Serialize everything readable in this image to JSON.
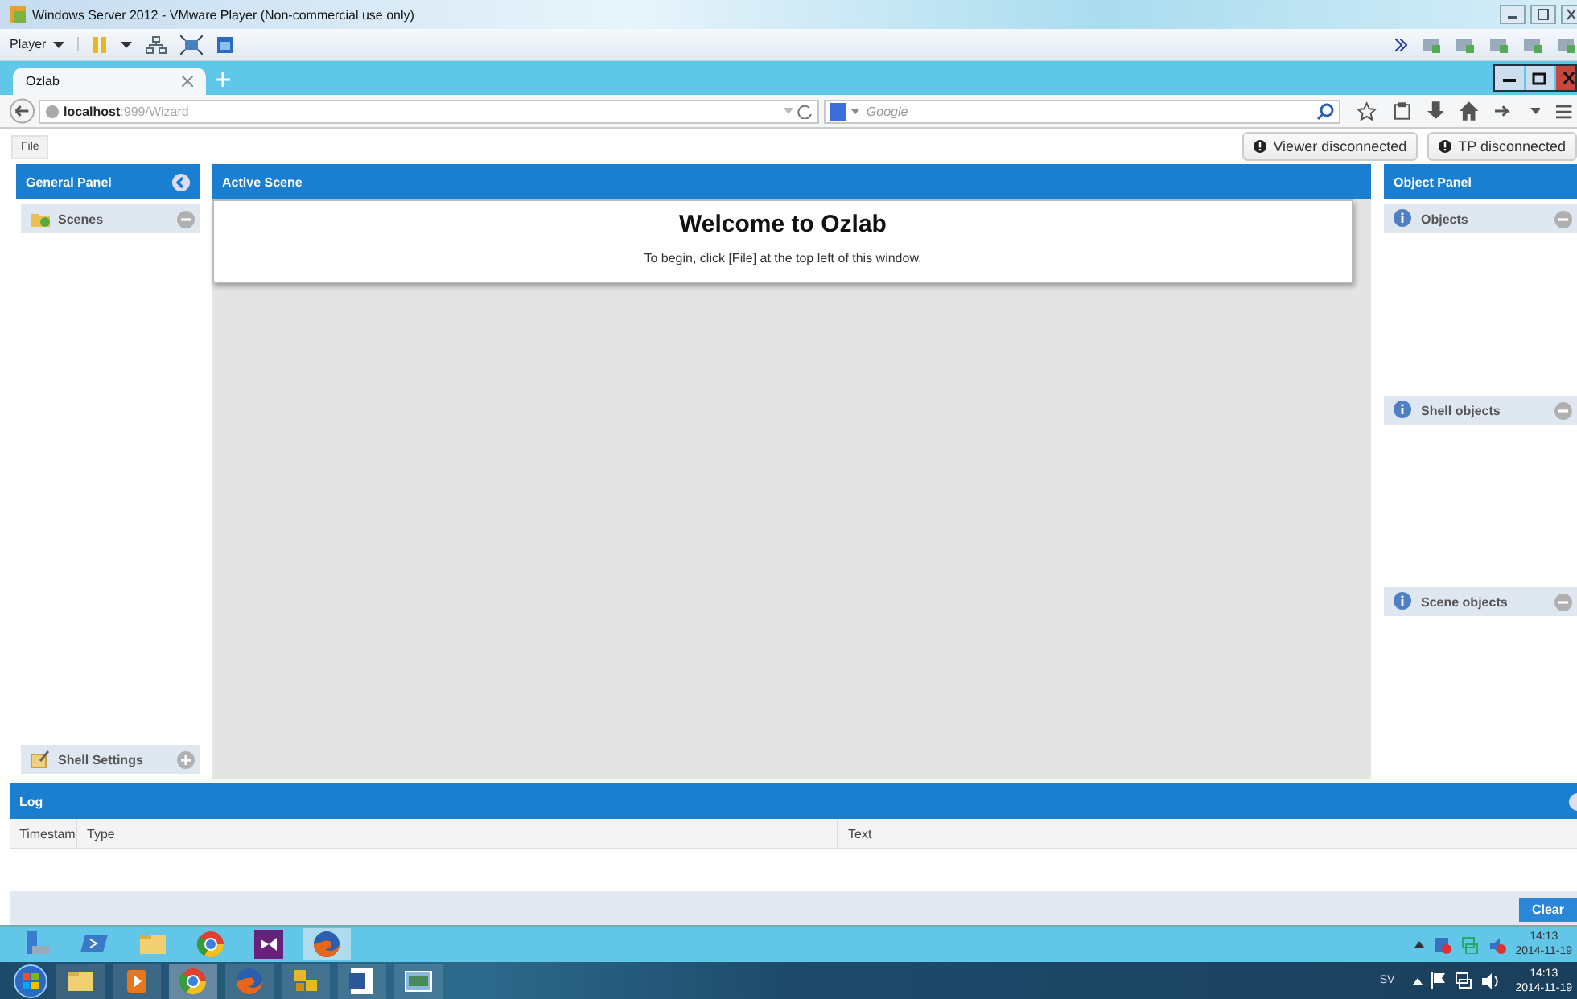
{
  "vm_window": {
    "title": "Windows Server 2012 - VMware Player (Non-commercial use only)",
    "menu": "Player"
  },
  "browser": {
    "tabs": [
      {
        "label": "Ozlab",
        "selected": true
      }
    ],
    "url_host": "localhost",
    "url_path": ":999/Wizard",
    "search": {
      "placeholder": "Google"
    }
  },
  "toolbar": {
    "file_button": "File",
    "status_buttons": [
      {
        "label": "Viewer disconnected"
      },
      {
        "label": "TP disconnected"
      }
    ]
  },
  "general_panel": {
    "title": "General Panel",
    "sections": [
      {
        "label": "Scenes",
        "kind": "folder",
        "expanded": true
      }
    ],
    "footer_sections": [
      {
        "label": "Shell Settings",
        "kind": "notepad",
        "expanded": false
      }
    ]
  },
  "active_scene": {
    "title": "Active Scene",
    "heading": "Welcome to Ozlab",
    "message": "To begin, click [File] at the top left of this window."
  },
  "object_panel": {
    "title": "Object Panel",
    "sections": [
      {
        "label": "Objects",
        "kind": "info",
        "expanded": true
      },
      {
        "label": "Shell objects",
        "kind": "info",
        "expanded": true
      },
      {
        "label": "Scene objects",
        "kind": "info",
        "expanded": true
      }
    ]
  },
  "log": {
    "title": "Log",
    "columns": [
      "Timestam",
      "Type",
      "Text"
    ],
    "clear_button": "Clear"
  },
  "guest_taskbar": {
    "time": "14:13",
    "date": "2014-11-19"
  },
  "host_taskbar": {
    "language": "SV",
    "time": "14:13",
    "date": "2014-11-19"
  }
}
